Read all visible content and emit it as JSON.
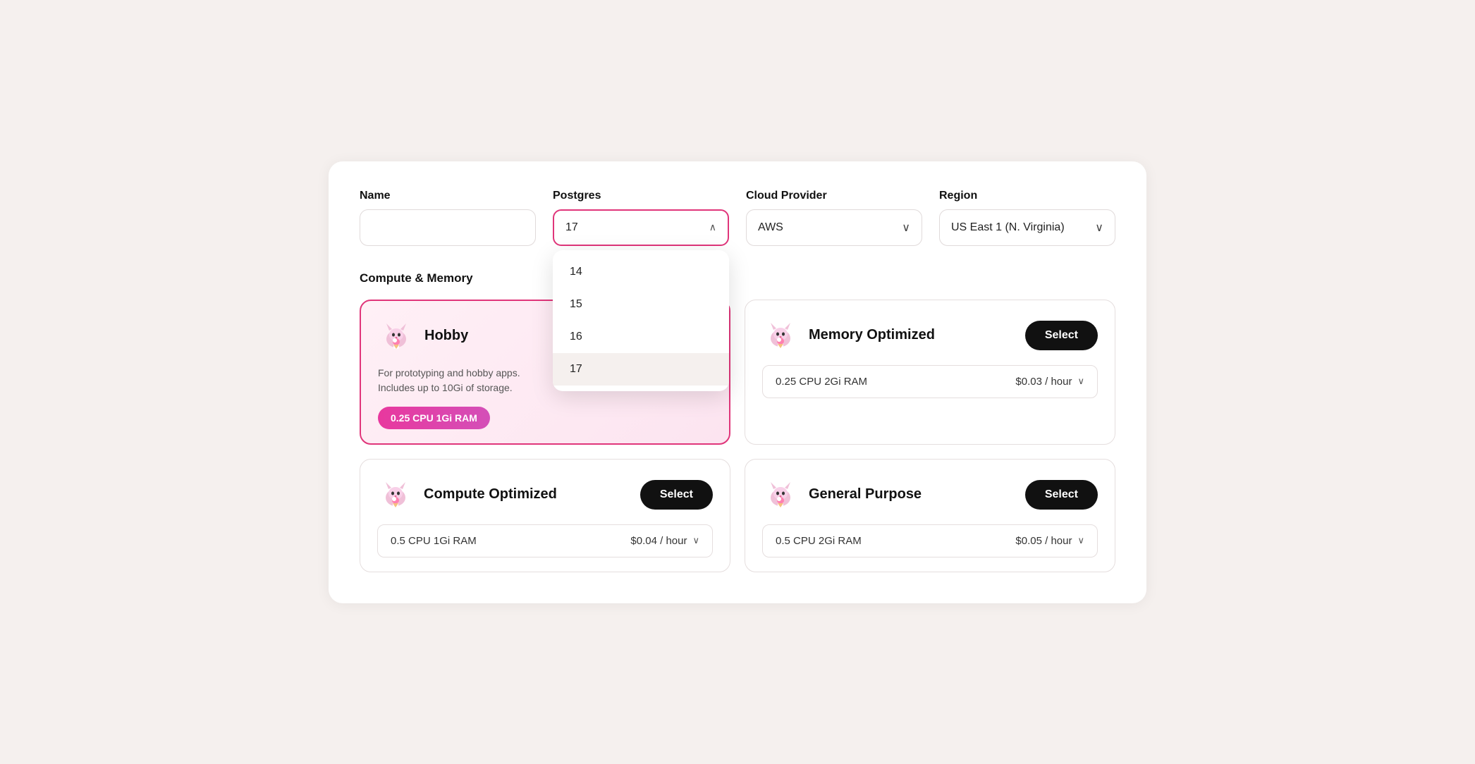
{
  "header": {
    "name_label": "Name",
    "postgres_label": "Postgres",
    "cloud_label": "Cloud Provider",
    "region_label": "Region",
    "postgres_selected": "17",
    "cloud_selected": "AWS",
    "region_selected": "US East 1 (N. Virginia)",
    "name_placeholder": ""
  },
  "postgres_options": [
    {
      "value": "14",
      "label": "14"
    },
    {
      "value": "15",
      "label": "15"
    },
    {
      "value": "16",
      "label": "16"
    },
    {
      "value": "17",
      "label": "17",
      "selected": true
    }
  ],
  "compute_section": {
    "title": "Compute & Memory"
  },
  "cards": [
    {
      "id": "hobby",
      "name": "Hobby",
      "selected": true,
      "description": "For prototyping and hobby apps.\nIncludes up to 10Gi of storage.",
      "badge": "0.25 CPU 1Gi RAM",
      "show_badge": true,
      "show_specs": false,
      "icon": "🐱"
    },
    {
      "id": "memory-optimized",
      "name": "Memory Optimized",
      "selected": false,
      "description": "",
      "show_badge": false,
      "show_specs": true,
      "specs": "0.25 CPU 2Gi RAM",
      "price": "$0.03 / hour",
      "icon": "🐱",
      "button_label": "Select"
    },
    {
      "id": "compute-optimized",
      "name": "Compute Optimized",
      "selected": false,
      "description": "",
      "show_badge": false,
      "show_specs": true,
      "specs": "0.5 CPU 1Gi RAM",
      "price": "$0.04 / hour",
      "icon": "🐱",
      "button_label": "Select"
    },
    {
      "id": "general-purpose",
      "name": "General Purpose",
      "selected": false,
      "description": "",
      "show_badge": false,
      "show_specs": true,
      "specs": "0.5 CPU 2Gi RAM",
      "price": "$0.05 / hour",
      "icon": "🐱",
      "button_label": "Select"
    }
  ],
  "icons": {
    "chevron_up": "∧",
    "chevron_down": "∨"
  }
}
